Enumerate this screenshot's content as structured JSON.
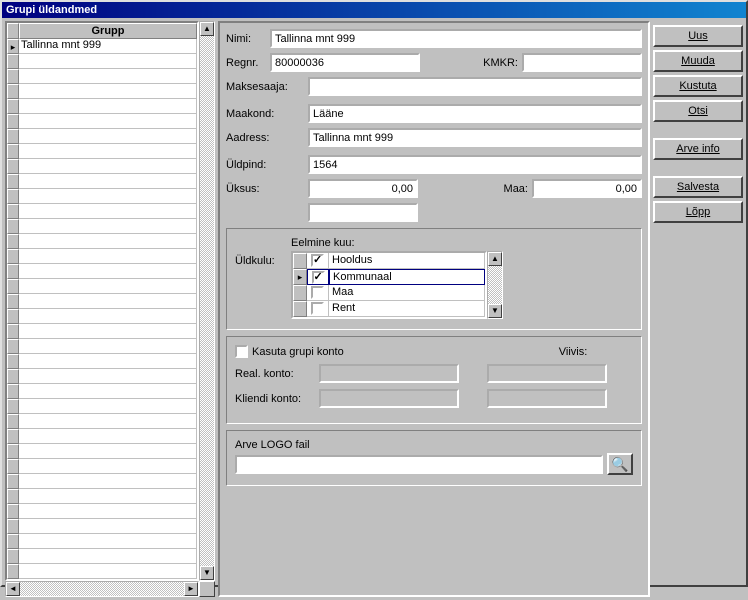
{
  "window": {
    "title": "Grupi üldandmed"
  },
  "grid": {
    "column_header": "Grupp",
    "rows": [
      "Tallinna mnt 999"
    ]
  },
  "form": {
    "nimi_label": "Nimi:",
    "nimi_value": "Tallinna mnt 999",
    "regnr_label": "Regnr.",
    "regnr_value": "80000036",
    "kmkr_label": "KMKR:",
    "kmkr_value": "",
    "maksesaaja_label": "Maksesaaja:",
    "maksesaaja_value": "",
    "maakond_label": "Maakond:",
    "maakond_value": "Lääne",
    "aadress_label": "Aadress:",
    "aadress_value": "Tallinna mnt 999",
    "uldpind_label": "Üldpind:",
    "uldpind_value": "1564",
    "uksus_label": "Üksus:",
    "uksus_num1": "0,00",
    "maa_label": "Maa:",
    "maa_value": "0,00",
    "uksus_extra": ""
  },
  "uldkulu": {
    "label": "Üldkulu:",
    "prev_label": "Eelmine kuu:",
    "rows": [
      {
        "checked": true,
        "label": "Hooldus",
        "current": false
      },
      {
        "checked": true,
        "label": "Kommunaal",
        "current": true
      },
      {
        "checked": false,
        "label": "Maa",
        "current": false
      },
      {
        "checked": false,
        "label": "Rent",
        "current": false
      }
    ]
  },
  "konto": {
    "use_group_label": "Kasuta grupi konto",
    "use_group_checked": false,
    "viivis_label": "Viivis:",
    "real_label": "Real. konto:",
    "real_value1": "",
    "real_value2": "",
    "kliendi_label": "Kliendi konto:",
    "kliendi_value1": "",
    "kliendi_value2": ""
  },
  "logo": {
    "label": "Arve LOGO fail",
    "value": ""
  },
  "buttons": {
    "uus": "Uus",
    "muuda": "Muuda",
    "kustuta": "Kustuta",
    "otsi": "Otsi",
    "arve_info": "Arve info",
    "salvesta": "Salvesta",
    "lopp": "Lõpp"
  }
}
